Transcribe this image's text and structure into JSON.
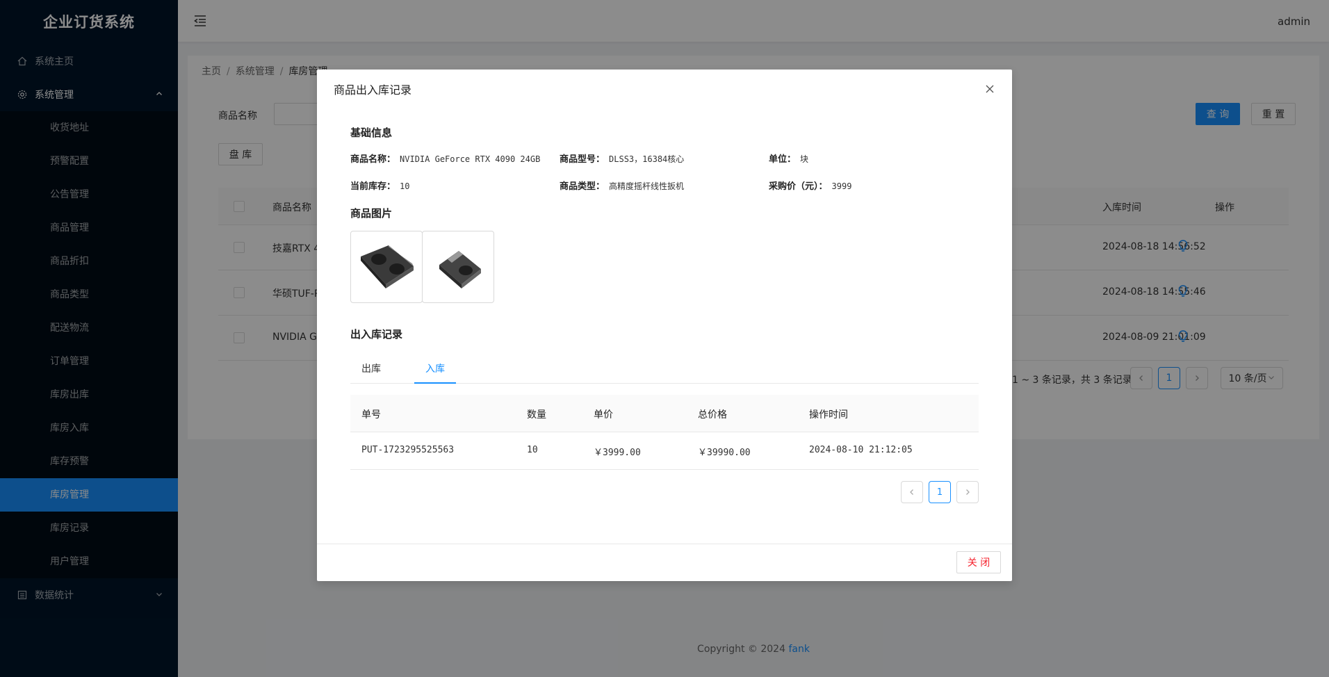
{
  "app": {
    "title": "企业订货系统",
    "user": "admin"
  },
  "sidebar": {
    "home": "系统主页",
    "system": "系统管理",
    "sub_items": [
      "收货地址",
      "预警配置",
      "公告管理",
      "商品管理",
      "商品折扣",
      "商品类型",
      "配送物流",
      "订单管理",
      "库房出库",
      "库房入库",
      "库存预警",
      "库房管理",
      "库房记录",
      "用户管理"
    ],
    "active_index": 11,
    "stats": "数据统计"
  },
  "breadcrumb": [
    "主页",
    "系统管理",
    "库房管理"
  ],
  "search": {
    "label": "商品名称",
    "value": "",
    "query_label": "查 询",
    "reset_label": "重 置",
    "check_label": "盘 库"
  },
  "table": {
    "headers": {
      "name": "商品名称",
      "time": "入库时间",
      "ops": "操作"
    },
    "rows": [
      {
        "name": "技嘉RTX 4",
        "time": "2024-08-18 14:56:52"
      },
      {
        "name": "华硕TUF-R",
        "time": "2024-08-18 14:55:46"
      },
      {
        "name": "NVIDIA Ge",
        "time": "2024-08-09 21:01:09"
      }
    ]
  },
  "pagination": {
    "info": "1 ~ 3 条记录，共 3 条记录",
    "current": "1",
    "page_size": "10 条/页"
  },
  "footer": {
    "copyright": "Copyright © 2024",
    "author": "fank"
  },
  "modal": {
    "title": "商品出入库记录",
    "basic_title": "基础信息",
    "fields": {
      "name_label": "商品名称：",
      "name": "NVIDIA GeForce RTX 4090 24GB",
      "model_label": "商品型号：",
      "model": "DLSS3，16384核心",
      "unit_label": "单位：",
      "unit": "块",
      "stock_label": "当前库存：",
      "stock": "10",
      "type_label": "商品类型：",
      "type": "高精度摇杆线性扳机",
      "price_label": "采购价（元）：",
      "price": "3999"
    },
    "image_title": "商品图片",
    "records_title": "出入库记录",
    "tabs": [
      "出库",
      "入库"
    ],
    "active_tab": 1,
    "table_headers": {
      "no": "单号",
      "qty": "数量",
      "unit_price": "单价",
      "total": "总价格",
      "time": "操作时间"
    },
    "rows": [
      {
        "no": "PUT-1723295525563",
        "qty": "10",
        "unit_price": "￥3999.00",
        "total": "￥39990.00",
        "time": "2024-08-10 21:12:05"
      }
    ],
    "current_page": "1",
    "close_label": "关 闭"
  },
  "colors": {
    "primary": "#1890ff",
    "sidebar_bg": "#001529",
    "danger": "#f5222d"
  }
}
